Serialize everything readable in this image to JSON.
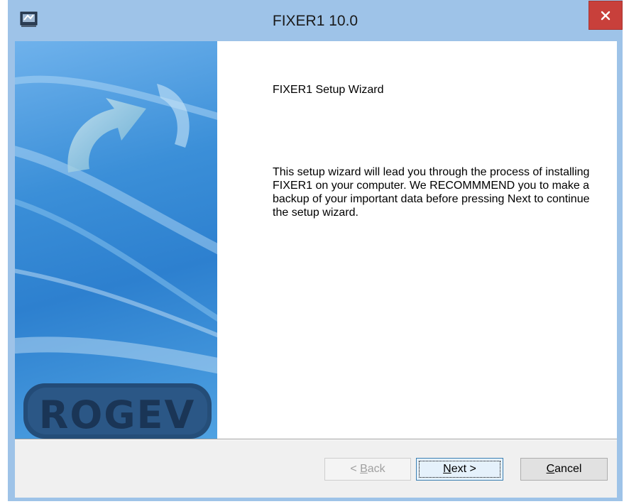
{
  "window": {
    "title": "FIXER1 10.0",
    "icon": "setup-app-icon",
    "close_icon": "close-icon"
  },
  "banner": {
    "logo_text": "ROGEV",
    "graphic": "curved-arrow-icon"
  },
  "content": {
    "heading": "FIXER1 Setup Wizard",
    "body": "This setup wizard will lead you through the process of installing FIXER1 on your computer. We RECOMMMEND you to make a backup of your important data before pressing Next to continue the setup wizard."
  },
  "buttons": {
    "back": {
      "prefix": "< ",
      "accel": "B",
      "rest": "ack",
      "enabled": false
    },
    "next": {
      "accel": "N",
      "rest": "ext >",
      "enabled": true,
      "focused": true
    },
    "cancel": {
      "accel": "C",
      "rest": "ancel",
      "enabled": true
    }
  },
  "colors": {
    "frame": "#9ec3e8",
    "close_button": "#c8403b",
    "banner_blue": "#3b8fd8",
    "logo": "#1f3f66"
  }
}
